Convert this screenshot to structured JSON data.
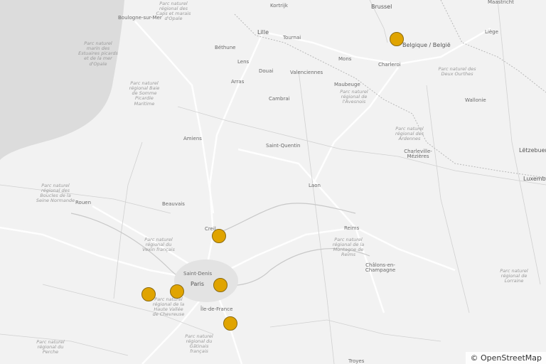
{
  "labels": {
    "boulogne": "Boulogne-sur-Mer",
    "parc_caps": "Parc naturel régional des Caps et marais d'Opale",
    "parc_estuaires": "Parc naturel marin des Estuaires picards et de la mer d'Opale",
    "kortrijk": "Kortrijk",
    "brussel": "Brussel",
    "maastricht": "Maastricht",
    "lille": "Lille",
    "tournai": "Tournai",
    "liege": "Liège",
    "belgique": "Belgique / België",
    "bethune": "Béthune",
    "lens": "Lens",
    "mons": "Mons",
    "charleroi": "Charleroi",
    "douai": "Douai",
    "valenciennes": "Valenciennes",
    "arras": "Arras",
    "maubeuge": "Maubeuge",
    "parc_avesnois": "Parc naturel régional de l'Avesnois",
    "parc_somme": "Parc naturel régional Baie de Somme Picardie Maritime",
    "cambrai": "Cambrai",
    "parc_famenne": "Parc naturel des Deux Ourthes",
    "wallonie": "Wallonie",
    "amiens": "Amiens",
    "saint_quentin": "Saint-Quentin",
    "parc_ardennes": "Parc naturel régional des Ardennes",
    "charleville": "Charleville-Mézières",
    "letzebuerg": "Lëtzebuerg",
    "luxembourg": "Luxemb",
    "parc_boucles": "Parc naturel régional des Boucles de la Seine Normande",
    "rouen": "Rouen",
    "laon": "Laon",
    "beauvais": "Beauvais",
    "creil": "Creil",
    "reims": "Reims",
    "parc_vexin": "Parc naturel régional du Vexin français",
    "parc_montagne_reims": "Parc naturel régional de la Montagne de Reims",
    "saint_denis": "Saint-Denis",
    "paris": "Paris",
    "chalons": "Châlons-en-Champagne",
    "ile_de_france": "Île-de-France",
    "parc_chevreuse": "Parc naturel régional de la Haute Vallée de Chevreuse",
    "parc_lorraine": "Parc naturel régional de Lorraine",
    "parc_gatinais": "Parc naturel régional du Gâtinais français",
    "parc_perche": "Parc naturel régional du Perche",
    "troyes": "Troyes"
  },
  "markers": [
    {
      "id": "brussels-area",
      "place": "Brussel"
    },
    {
      "id": "creil-area",
      "place": "Creil"
    },
    {
      "id": "west-paris-outer",
      "place": "Paris"
    },
    {
      "id": "west-paris-inner",
      "place": "Paris"
    },
    {
      "id": "east-paris",
      "place": "Paris"
    },
    {
      "id": "south-paris",
      "place": "Île-de-France"
    }
  ],
  "attribution": "© OpenStreetMap",
  "colors": {
    "marker_fill": "#e0a400",
    "marker_stroke": "#8a6a10",
    "land": "#f2f2f2",
    "sea": "#dcdcdc"
  }
}
